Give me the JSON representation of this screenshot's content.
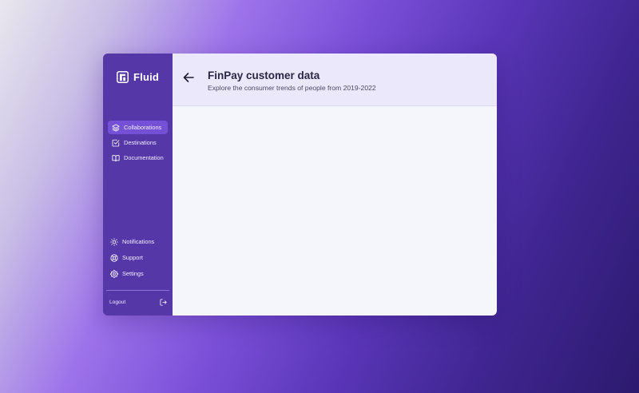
{
  "app": {
    "name": "Fluid"
  },
  "sidebar": {
    "items": [
      {
        "label": "Collaborations",
        "icon": "layers-icon",
        "active": true
      },
      {
        "label": "Destinations",
        "icon": "checkbox-icon",
        "active": false
      },
      {
        "label": "Documentation",
        "icon": "book-icon",
        "active": false
      }
    ],
    "bottom_items": [
      {
        "label": "Notifications",
        "icon": "sun-icon"
      },
      {
        "label": "Support",
        "icon": "lifebuoy-icon"
      },
      {
        "label": "Settings",
        "icon": "gear-icon"
      }
    ],
    "logout_label": "Logout"
  },
  "header": {
    "title": "FinPay customer data",
    "subtitle": "Explore the consumer trends of people from 2019-2022"
  },
  "colors": {
    "sidebar_bg": "#5637a8",
    "active_item_bg": "#7450d6",
    "header_bg": "#ebe8fb",
    "content_bg": "#f4f6fb"
  }
}
